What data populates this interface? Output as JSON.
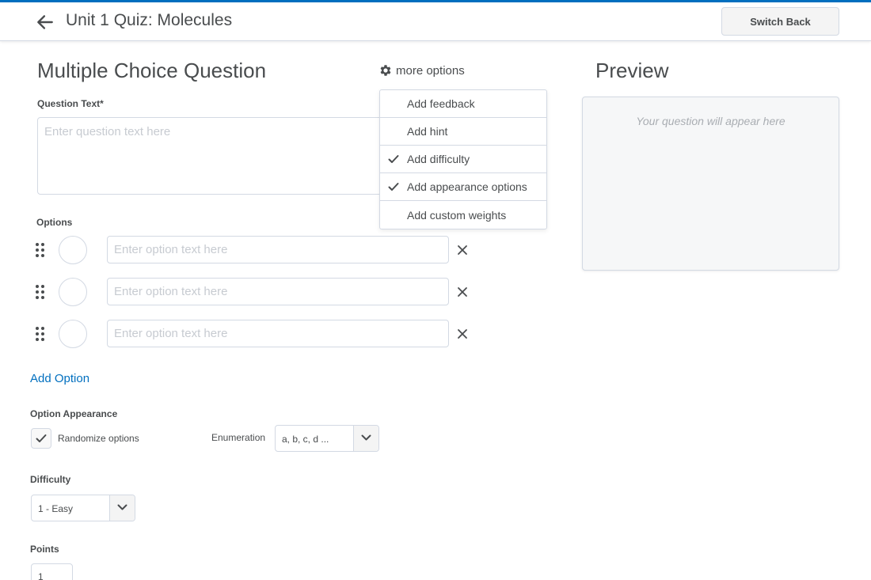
{
  "header": {
    "title": "Unit 1 Quiz: Molecules",
    "back_icon": "arrow-left-icon",
    "switch_back_label": "Switch Back",
    "accent_color": "#006fbf"
  },
  "editor": {
    "section_title": "Multiple Choice Question",
    "more_options_label": "more options",
    "more_options_icon": "gear-icon",
    "question_text_label": "Question Text*",
    "question_text_placeholder": "Enter question text here",
    "question_text_value": ""
  },
  "more_options_menu": {
    "items": [
      {
        "label": "Add feedback",
        "checked": false
      },
      {
        "label": "Add hint",
        "checked": false
      },
      {
        "label": "Add difficulty",
        "checked": true
      },
      {
        "label": "Add appearance options",
        "checked": true
      },
      {
        "label": "Add custom weights",
        "checked": false
      }
    ]
  },
  "options": {
    "label": "Options",
    "items": [
      {
        "placeholder": "Enter option text here",
        "value": ""
      },
      {
        "placeholder": "Enter option text here",
        "value": ""
      },
      {
        "placeholder": "Enter option text here",
        "value": ""
      }
    ],
    "add_option_label": "Add Option"
  },
  "option_appearance": {
    "label": "Option Appearance",
    "randomize_label": "Randomize options",
    "randomize_checked": true,
    "enumeration_label": "Enumeration",
    "enumeration_value": "a, b, c, d ..."
  },
  "difficulty": {
    "label": "Difficulty",
    "value": "1 - Easy"
  },
  "points": {
    "label": "Points",
    "value": "1"
  },
  "preview": {
    "title": "Preview",
    "placeholder": "Your question will appear here"
  }
}
